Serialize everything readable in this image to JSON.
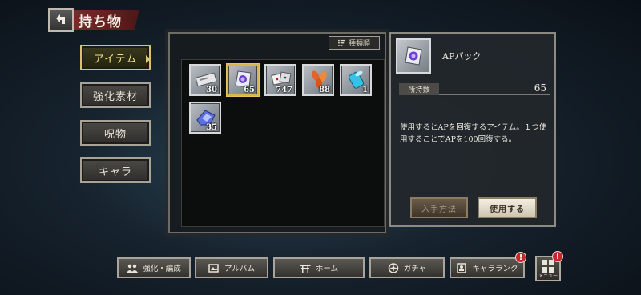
{
  "header": {
    "title": "持ち物"
  },
  "tabs": [
    {
      "label": "アイテム",
      "active": true
    },
    {
      "label": "強化素材",
      "active": false
    },
    {
      "label": "呪物",
      "active": false
    },
    {
      "label": "キャラ",
      "active": false
    }
  ],
  "sort": {
    "label": "種類順"
  },
  "items": [
    {
      "icon": "ticket-icon",
      "count": "30"
    },
    {
      "icon": "ap-pack-icon",
      "count": "65",
      "selected": true
    },
    {
      "icon": "dice-icon",
      "count": "747"
    },
    {
      "icon": "leaves-icon",
      "count": "88"
    },
    {
      "icon": "cylinder-icon",
      "count": "1"
    },
    {
      "icon": "crystal-fragments-icon",
      "count": "35"
    }
  ],
  "detail": {
    "name": "APパック",
    "own_label": "所持数",
    "own_value": "65",
    "description": "使用するとAPを回復するアイテム。１つ使用することでAPを100回復する。",
    "acquire_label": "入手方法",
    "use_label": "使用する"
  },
  "nav": {
    "enhance": "強化・編成",
    "album": "アルバム",
    "home": "ホーム",
    "gacha": "ガチャ",
    "rank": "キャラランク",
    "menu": "メニュー",
    "badge": "!"
  },
  "colors": {
    "accent": "#d9c26a",
    "badge": "#c7262a",
    "title_banner": "#7a2a2a"
  }
}
